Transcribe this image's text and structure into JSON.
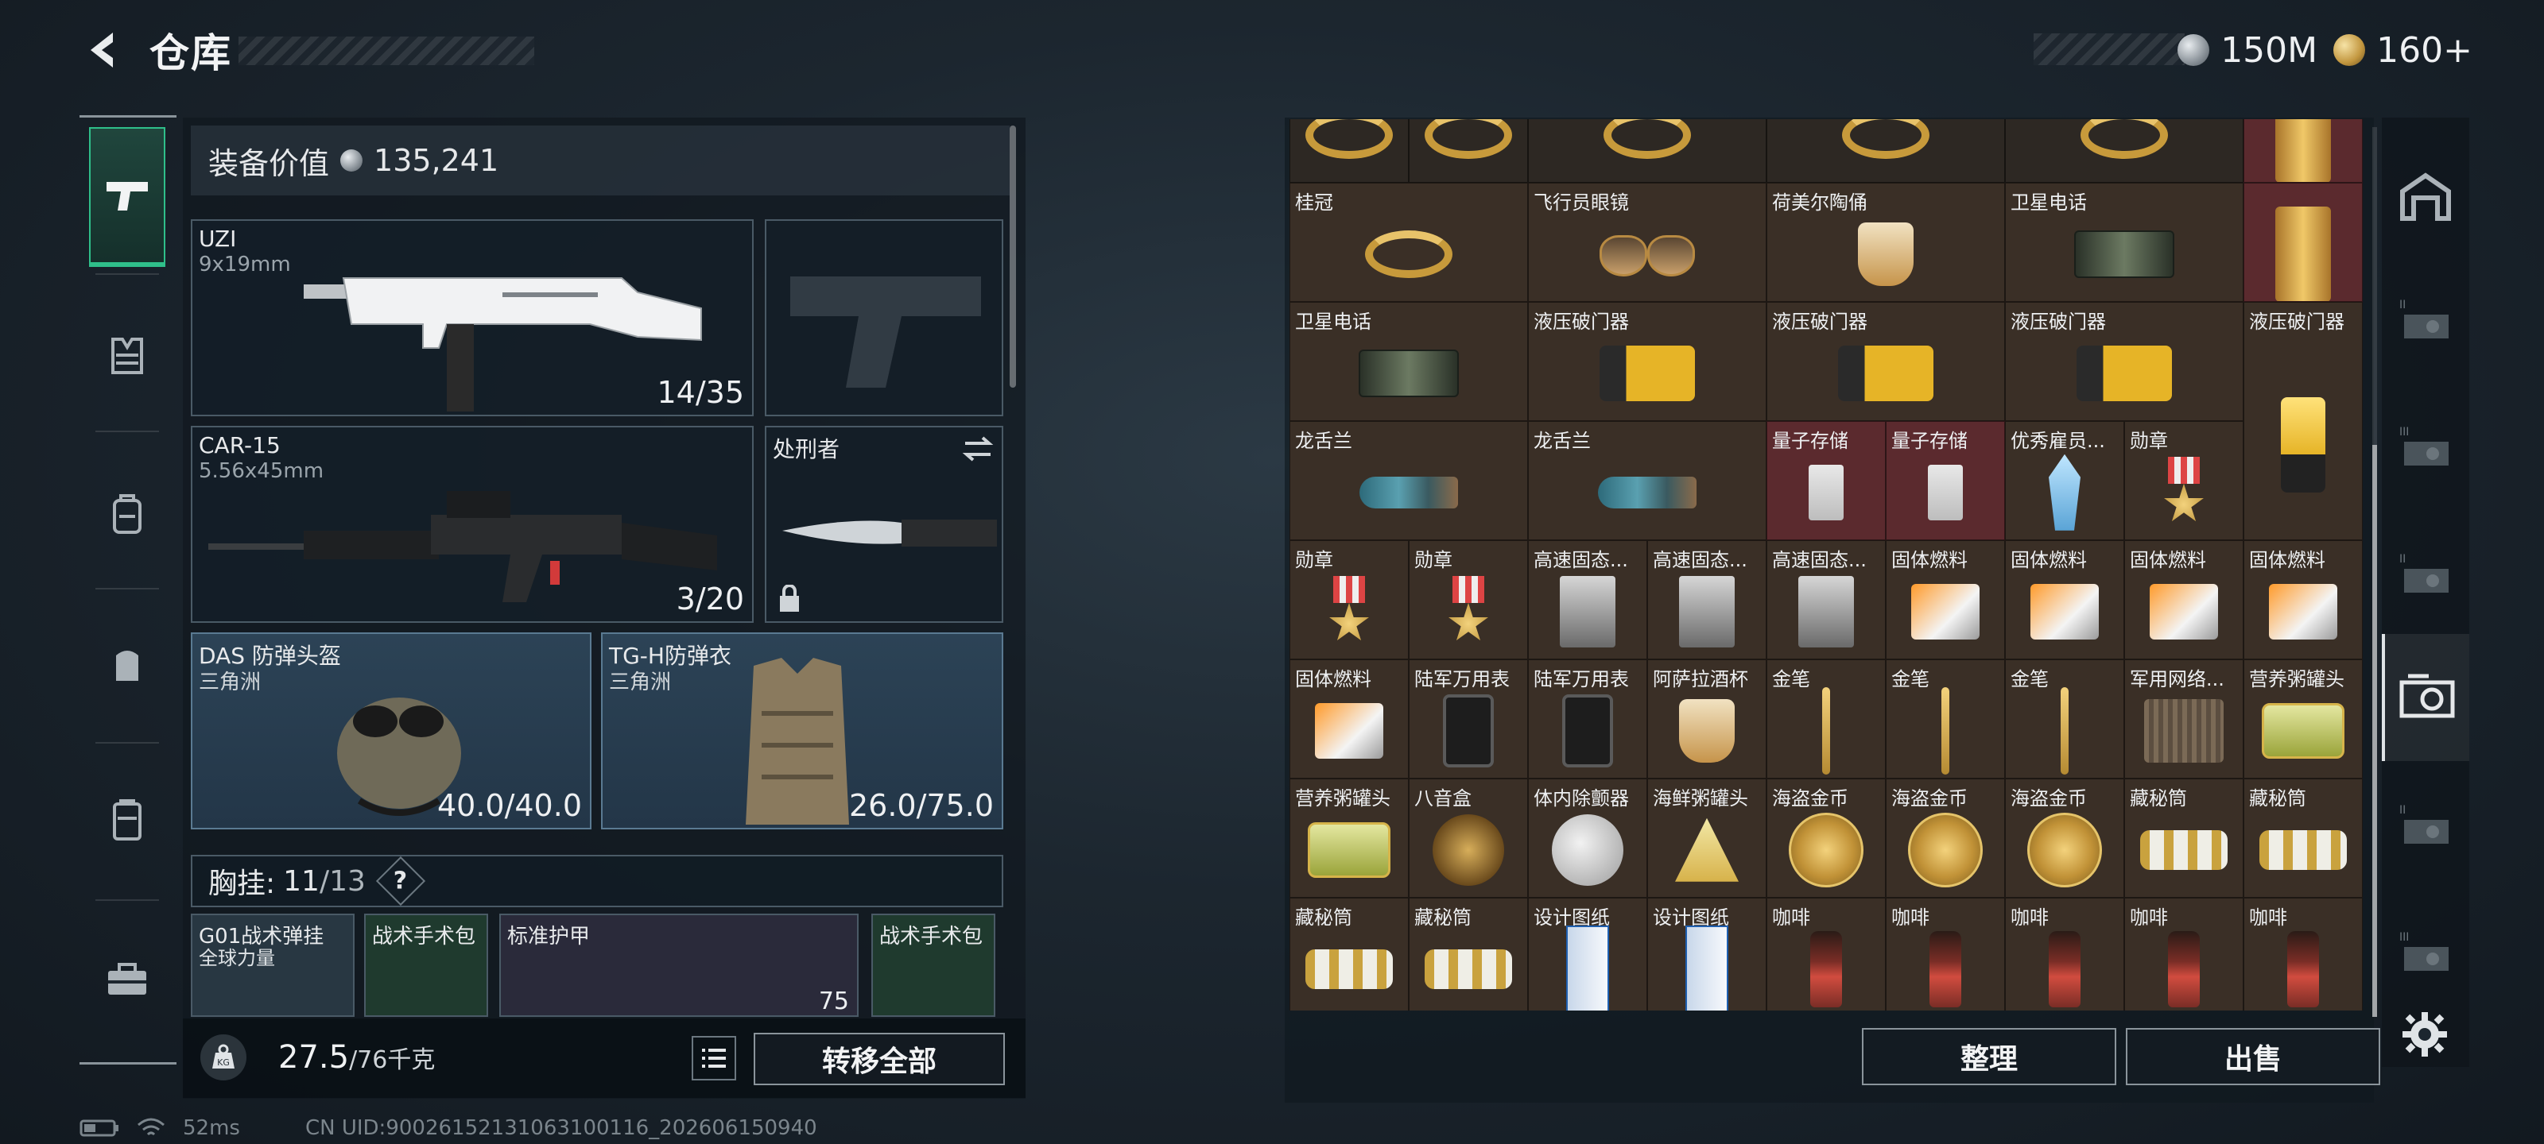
{
  "title": "仓库",
  "currency": {
    "silver": "150M",
    "gold": "160+"
  },
  "equipment": {
    "value_label": "装备价值",
    "value": "135,241",
    "primary": {
      "name": "UZI",
      "caliber": "9x19mm",
      "ammo": "14/35"
    },
    "secondary": {
      "name": "CAR-15",
      "caliber": "5.56x45mm",
      "ammo": "3/20"
    },
    "melee": {
      "name": "处刑者"
    },
    "helmet": {
      "name": "DAS 防弹头盔",
      "faction": "三角洲",
      "durability": "40.0/40.0"
    },
    "armor": {
      "name": "TG-H防弹衣",
      "faction": "三角洲",
      "durability": "26.0/75.0"
    },
    "chest": {
      "label": "胸挂:",
      "used": "11",
      "total": "/13",
      "help": "?"
    },
    "sub_items": [
      {
        "name": "G01战术弹挂",
        "sub": "全球力量"
      },
      {
        "name": "战术手术包"
      },
      {
        "name": "标准护甲",
        "value": "75"
      },
      {
        "name": "战术手术包"
      }
    ],
    "weight": {
      "current": "27.5",
      "max": "/76千克",
      "icon": "KG"
    },
    "transfer_all": "转移全部"
  },
  "inventory": {
    "sort_button": "整理",
    "sell_button": "出售",
    "rows": [
      [
        "",
        "",
        "",
        "",
        ""
      ],
      [
        "桂冠",
        "飞行员眼镜",
        "荷美尔陶俑",
        "卫星电话",
        ""
      ],
      [
        "卫星电话",
        "液压破门器",
        "液压破门器",
        "液压破门器",
        "液压破门器"
      ],
      [
        "龙舌兰",
        "龙舌兰",
        "量子存储",
        "量子存储",
        "优秀雇员...",
        "勋章",
        ""
      ],
      [
        "勋章",
        "勋章",
        "高速固态...",
        "高速固态...",
        "高速固态...",
        "固体燃料",
        "固体燃料",
        "固体燃料",
        "固体燃料"
      ],
      [
        "固体燃料",
        "陆军万用表",
        "陆军万用表",
        "阿萨拉酒杯",
        "金笔",
        "金笔",
        "金笔",
        "军用网络...",
        "营养粥罐头"
      ],
      [
        "营养粥罐头",
        "八音盒",
        "体内除颤器",
        "海鲜粥罐头",
        "海盗金币",
        "海盗金币",
        "海盗金币",
        "藏秘筒",
        "藏秘筒"
      ],
      [
        "藏秘筒",
        "藏秘筒",
        "设计图纸",
        "设计图纸",
        "咖啡",
        "咖啡",
        "咖啡",
        "咖啡",
        "咖啡"
      ]
    ]
  },
  "status": {
    "ping": "52ms",
    "uid": "CN UID:9002615213106310011​6_202606150940"
  },
  "icons": {
    "left_nav": [
      "pistol-icon",
      "vest-icon",
      "backpack-icon",
      "pouch-icon",
      "case-icon",
      "toolbox-icon"
    ],
    "right_nav": [
      "warehouse-icon",
      "stash-2-icon",
      "stash-3-icon",
      "stash-2b-icon",
      "stash-active-icon",
      "stash-2c-icon",
      "stash-3b-icon",
      "settings-icon"
    ]
  }
}
